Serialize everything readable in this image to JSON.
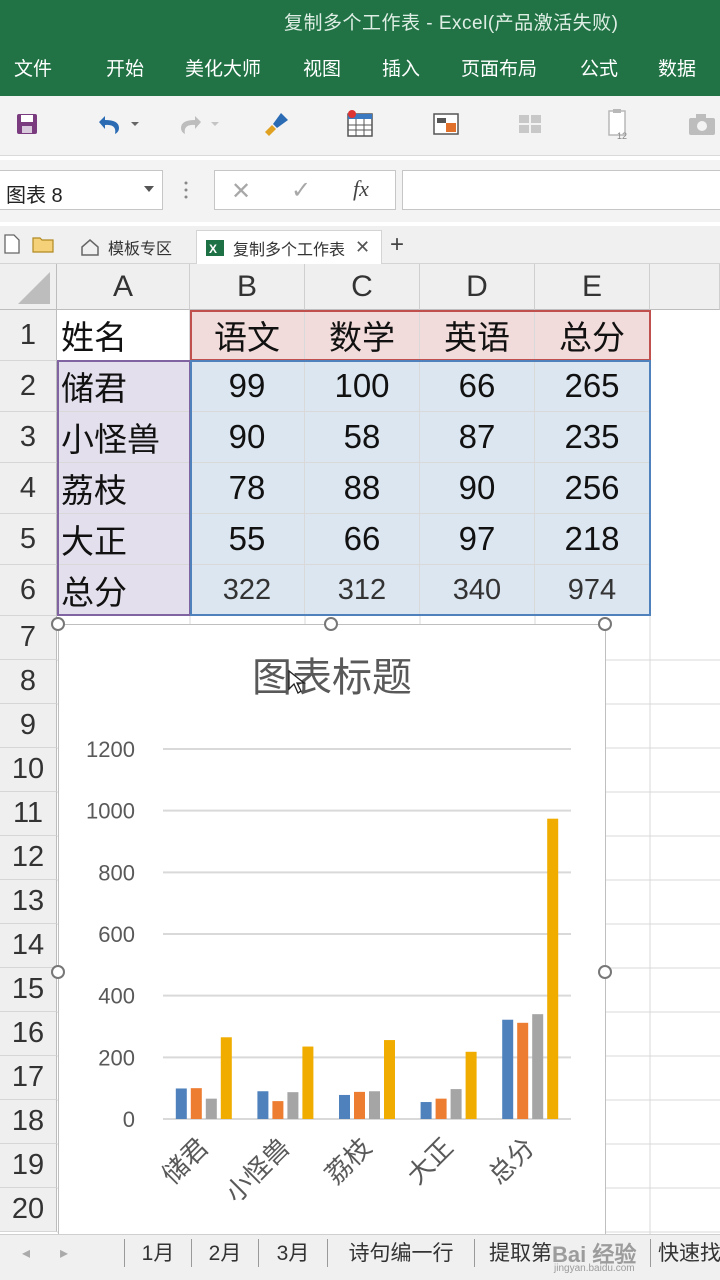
{
  "window": {
    "title": "复制多个工作表 - Excel(产品激活失败)"
  },
  "menu": [
    "文件",
    "开始",
    "美化大师",
    "视图",
    "插入",
    "页面布局",
    "公式",
    "数据"
  ],
  "namebox": {
    "value": "图表 8"
  },
  "formula": {
    "fx_label": "fx",
    "value": ""
  },
  "doc_tabs": [
    {
      "label": "模板专区"
    },
    {
      "label": "复制多个工作表"
    }
  ],
  "grid": {
    "columns": [
      "A",
      "B",
      "C",
      "D",
      "E"
    ],
    "rows": [
      "1",
      "2",
      "3",
      "4",
      "5",
      "6",
      "7",
      "8",
      "9",
      "10",
      "11",
      "12",
      "13",
      "14",
      "15",
      "16",
      "17",
      "18",
      "19",
      "20"
    ],
    "table": [
      [
        "姓名",
        "语文",
        "数学",
        "英语",
        "总分"
      ],
      [
        "储君",
        "99",
        "100",
        "66",
        "265"
      ],
      [
        "小怪兽",
        "90",
        "58",
        "87",
        "235"
      ],
      [
        "荔枝",
        "78",
        "88",
        "90",
        "256"
      ],
      [
        "大正",
        "55",
        "66",
        "97",
        "218"
      ],
      [
        "总分",
        "322",
        "312",
        "340",
        "974"
      ]
    ]
  },
  "chart_data": {
    "type": "bar",
    "title": "图表标题",
    "categories": [
      "储君",
      "小怪兽",
      "荔枝",
      "大正",
      "总分"
    ],
    "series": [
      {
        "name": "语文",
        "color": "#4f81bd",
        "values": [
          99,
          90,
          78,
          55,
          322
        ]
      },
      {
        "name": "数学",
        "color": "#ed7d31",
        "values": [
          100,
          58,
          88,
          66,
          312
        ]
      },
      {
        "name": "英语",
        "color": "#a5a5a5",
        "values": [
          66,
          87,
          90,
          97,
          340
        ]
      },
      {
        "name": "总分",
        "color": "#f0ad00",
        "values": [
          265,
          235,
          256,
          218,
          974
        ]
      }
    ],
    "ylim": [
      0,
      1200
    ],
    "yticks": [
      "0",
      "200",
      "400",
      "600",
      "800",
      "1000",
      "1200"
    ],
    "grid": true,
    "legend": "none"
  },
  "sheets": [
    "1月",
    "2月",
    "3月",
    "诗句编一行",
    "提取第",
    "快速找"
  ],
  "watermark": {
    "text": "Bai 经验",
    "sub": "jingyan.baidu.com"
  },
  "colors": {
    "ribbon": "#217346",
    "header_fill": "#f2dcdb",
    "data_fill": "#dce6f1",
    "name_fill": "#e4dfec"
  }
}
